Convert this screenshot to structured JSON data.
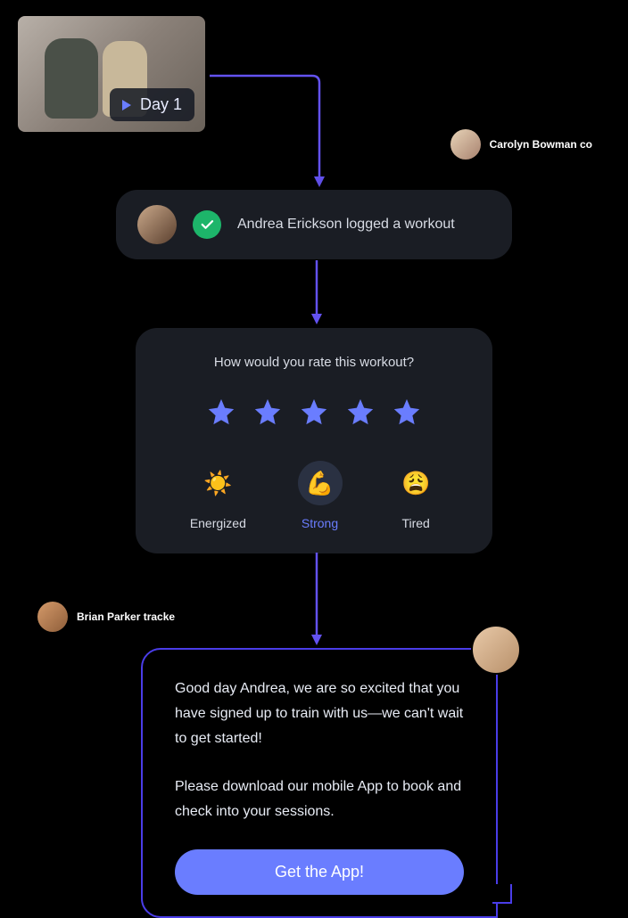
{
  "video": {
    "day_label": "Day 1"
  },
  "floating_users": {
    "user1": "Carolyn Bowman co",
    "user2": "Brian Parker tracke"
  },
  "logged": {
    "text": "Andrea Erickson logged a workout"
  },
  "rating": {
    "title": "How would you rate this workout?",
    "feelings": [
      {
        "emoji": "☀️",
        "label": "Energized"
      },
      {
        "emoji": "💪",
        "label": "Strong"
      },
      {
        "emoji": "😩",
        "label": "Tired"
      }
    ]
  },
  "message": {
    "paragraph1": "Good day Andrea, we are so excited that you have signed up to train with us—we can't wait to get started!",
    "paragraph2": "Please download our mobile App to book and check into your sessions.",
    "cta": "Get the App!"
  }
}
